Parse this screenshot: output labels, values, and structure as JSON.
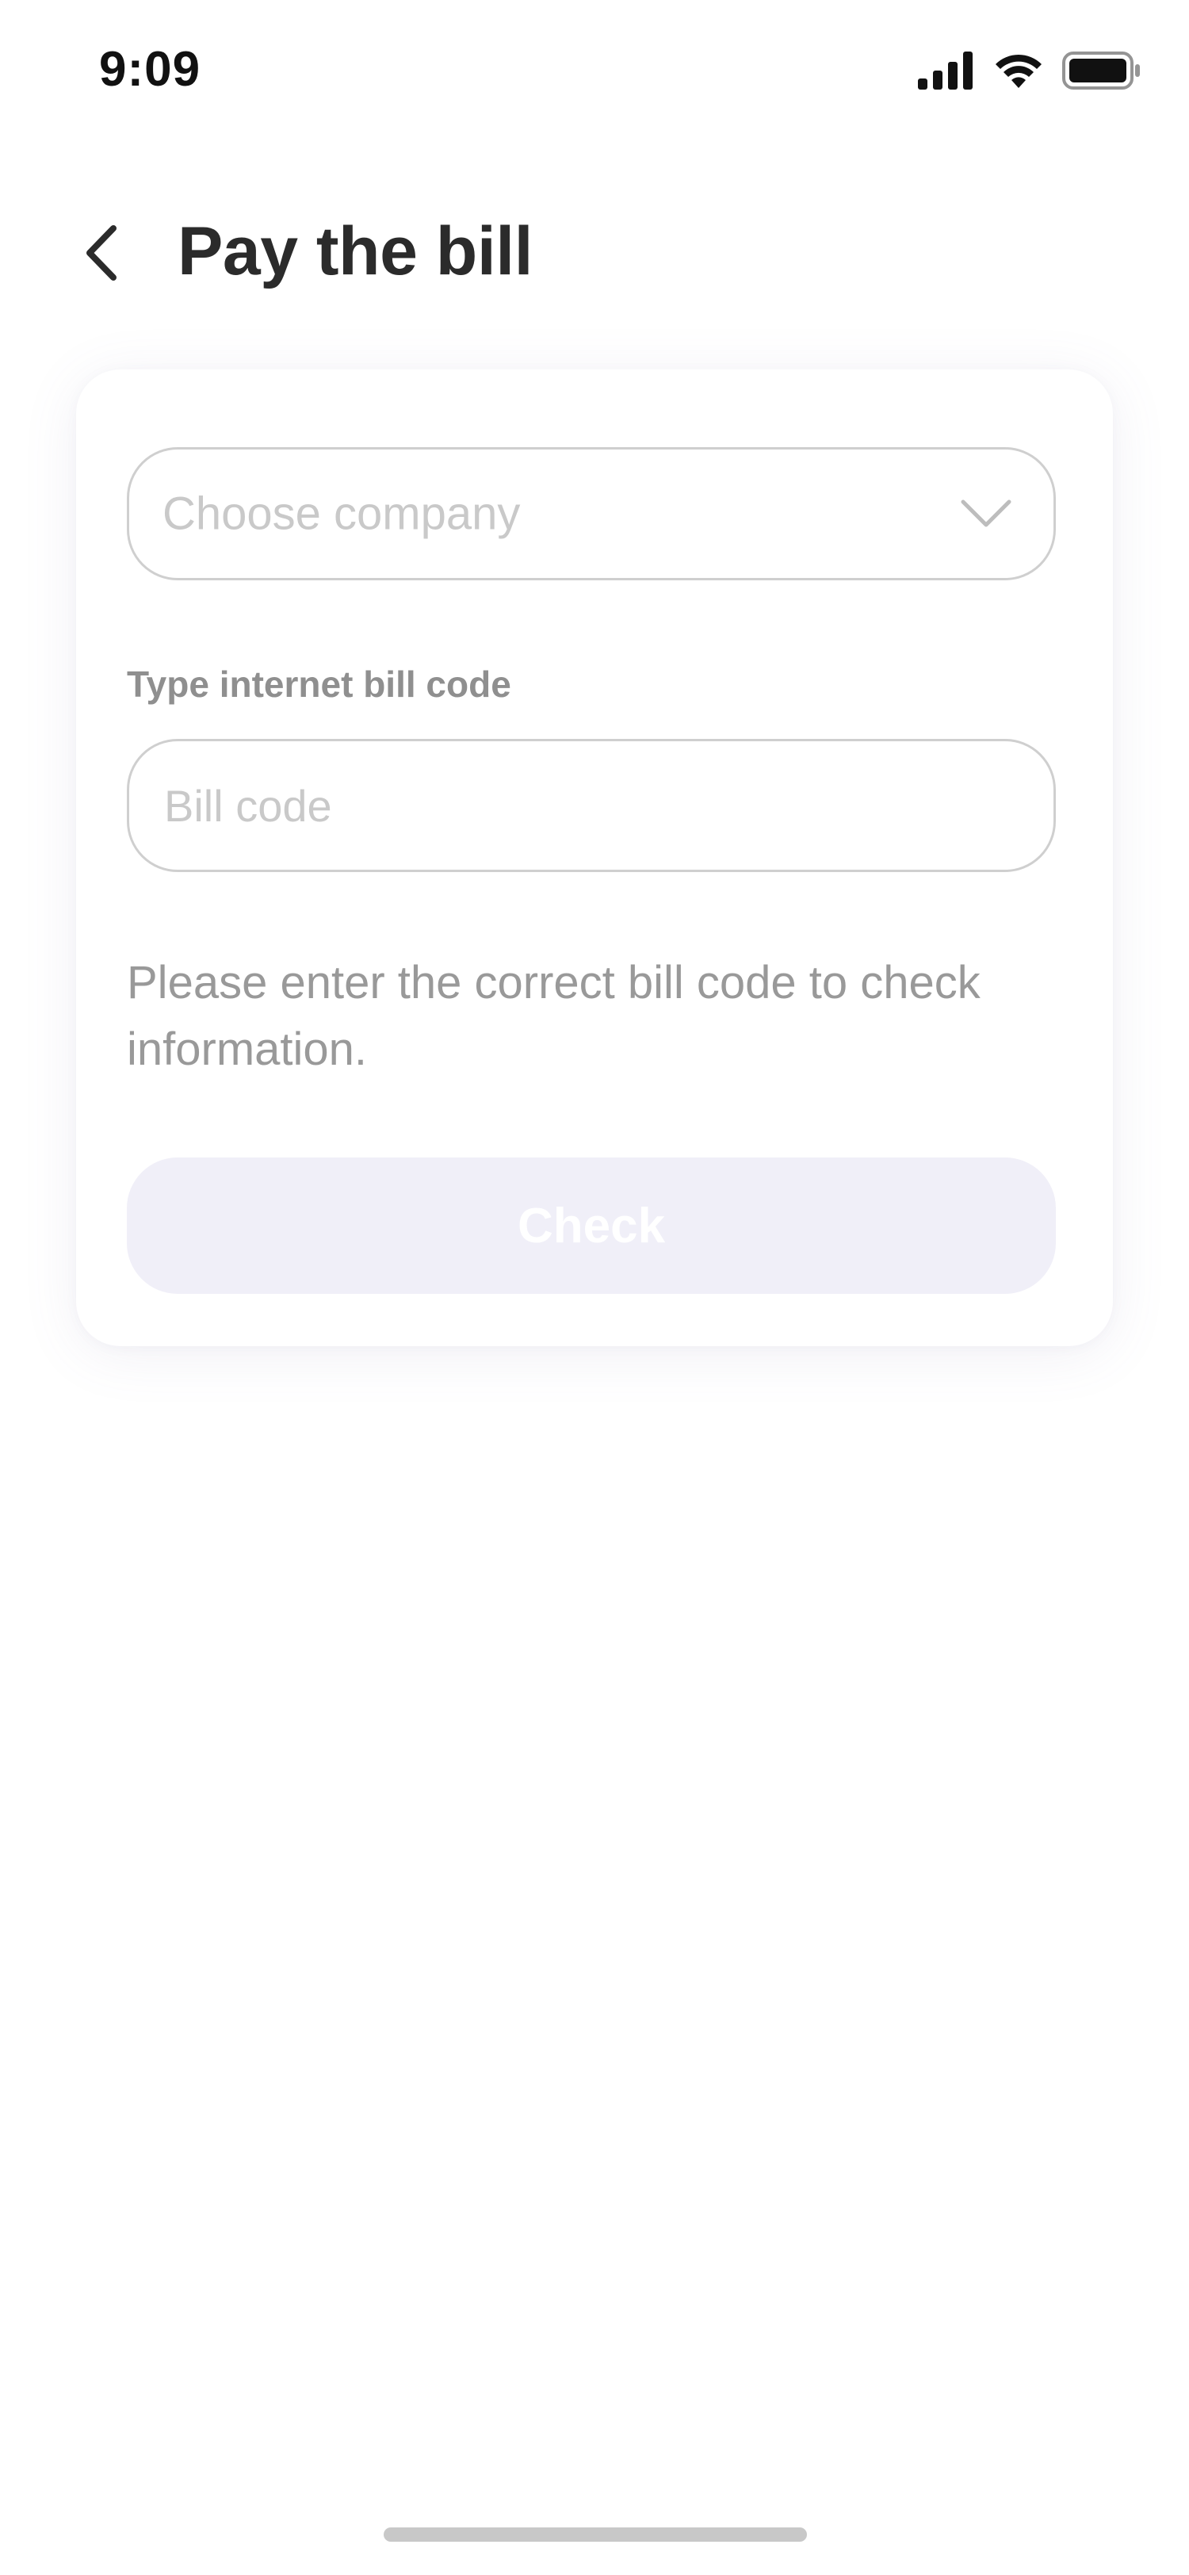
{
  "status_bar": {
    "time": "9:09"
  },
  "header": {
    "title": "Pay the bill",
    "back_icon": "chevron-left-icon"
  },
  "form": {
    "company_select": {
      "placeholder": "Choose company",
      "icon": "chevron-down-icon"
    },
    "bill_code_label": "Type internet bill code",
    "bill_code_input": {
      "placeholder": "Bill code",
      "value": ""
    },
    "help_text": "Please enter the correct bill code to check information.",
    "check_button_label": "Check"
  },
  "colors": {
    "title": "#2B2B2B",
    "placeholder": "#C9C9C9",
    "label": "#8F8F8F",
    "help": "#999999",
    "field_border": "#CFCFCF",
    "button_disabled_bg": "#F0EFF8",
    "button_text": "#FFFFFF"
  }
}
